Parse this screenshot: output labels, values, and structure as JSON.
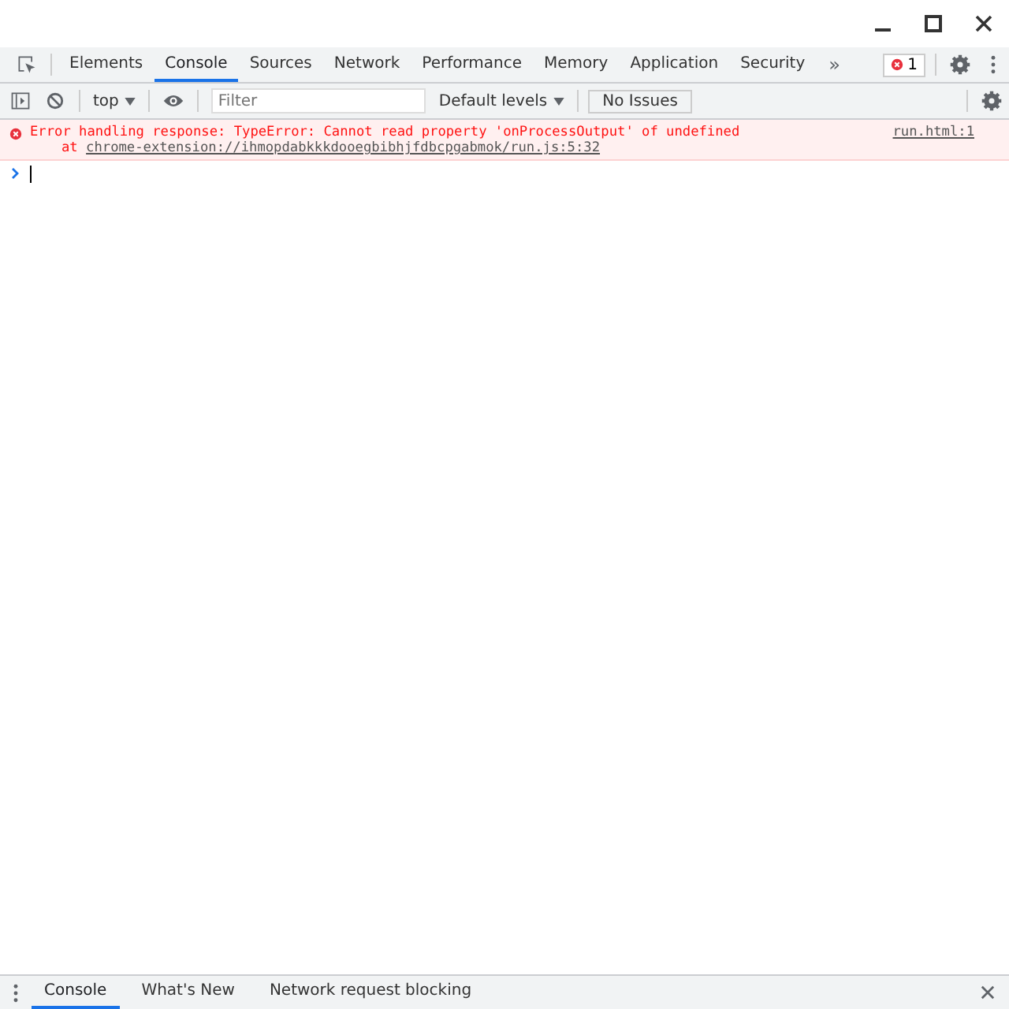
{
  "tabs": [
    {
      "label": "Elements",
      "selected": false
    },
    {
      "label": "Console",
      "selected": true
    },
    {
      "label": "Sources",
      "selected": false
    },
    {
      "label": "Network",
      "selected": false
    },
    {
      "label": "Performance",
      "selected": false
    },
    {
      "label": "Memory",
      "selected": false
    },
    {
      "label": "Application",
      "selected": false
    },
    {
      "label": "Security",
      "selected": false
    }
  ],
  "more_tabs": "»",
  "error_count": "1",
  "toolbar": {
    "context": "top",
    "filter": {
      "placeholder": "Filter"
    },
    "levels": "Default levels",
    "issues": "No Issues"
  },
  "messages": [
    {
      "kind": "error",
      "text": "Error handling response: TypeError: Cannot read property 'onProcessOutput' of undefined",
      "stack_prefix": "at",
      "stack_link": "chrome-extension://ihmopdabkkkdooegbibhjfdbcpgabmok/run.js:5:32",
      "source": "run.html:1"
    }
  ],
  "drawer_tabs": [
    {
      "label": "Console",
      "selected": true
    },
    {
      "label": "What's New",
      "selected": false
    },
    {
      "label": "Network request blocking",
      "selected": false
    }
  ]
}
